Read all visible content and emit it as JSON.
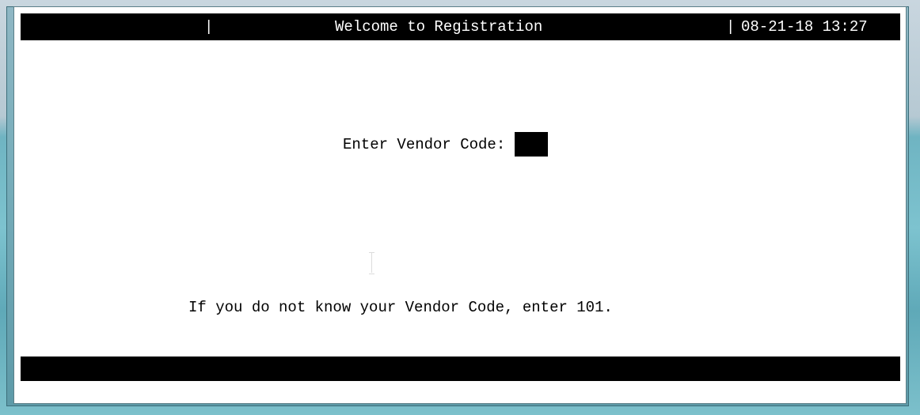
{
  "header": {
    "separator_left": "|",
    "title": "Welcome to Registration",
    "separator_right": "|",
    "datetime": "08-21-18 13:27"
  },
  "prompt": {
    "label": "Enter Vendor Code:",
    "value": ""
  },
  "hint": {
    "text": "If you do not know your Vendor Code, enter 101."
  }
}
